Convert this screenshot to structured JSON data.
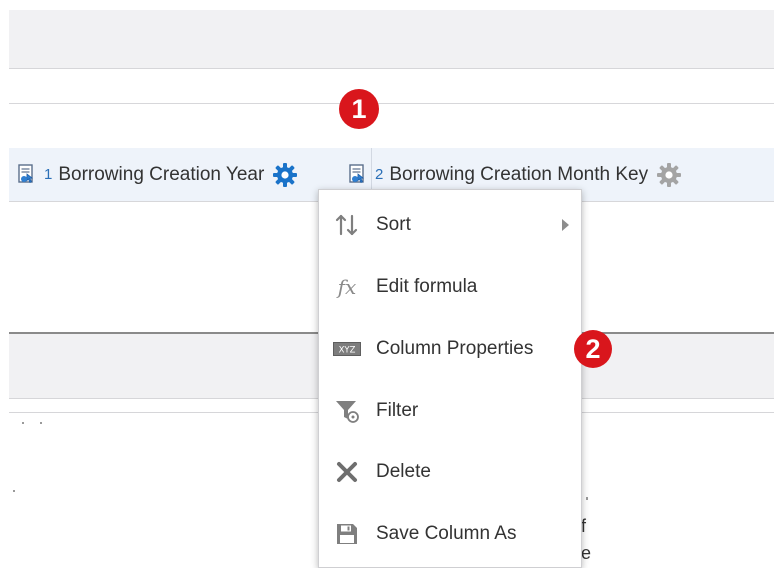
{
  "columns": [
    {
      "index": "1",
      "label": "Borrowing Creation Year",
      "icon": "column-key-icon",
      "gear_color": "#1a73c9"
    },
    {
      "index": "2",
      "label": "Borrowing Creation Month Key",
      "icon": "column-key-icon",
      "gear_color": "#a4a4a4"
    }
  ],
  "badges": {
    "first": "1",
    "second": "2",
    "color": "#d9161c"
  },
  "menu": {
    "items": [
      {
        "label": "Sort",
        "icon": "sort-icon",
        "has_submenu": true
      },
      {
        "label": "Edit formula",
        "icon": "fx-icon"
      },
      {
        "label": "Column Properties",
        "icon": "xyz-icon"
      },
      {
        "label": "Filter",
        "icon": "filter-icon"
      },
      {
        "label": "Delete",
        "icon": "delete-x-icon"
      },
      {
        "label": "Save Column As",
        "icon": "save-icon"
      }
    ],
    "fx_glyph": "fx",
    "xyz_glyph": "XYZ"
  },
  "background_fragments": [
    "f",
    "e"
  ]
}
